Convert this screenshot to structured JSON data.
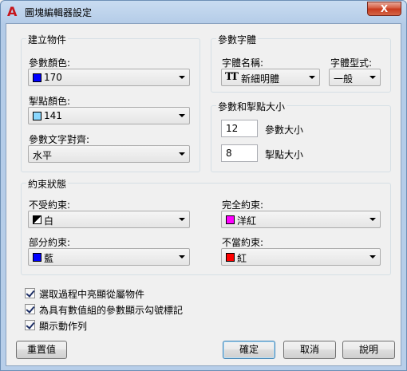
{
  "window": {
    "title": "圖塊編輯器設定",
    "close_label": "X"
  },
  "create_group": {
    "title": "建立物件",
    "param_color_label": "參數顏色:",
    "param_color": {
      "value": "170",
      "swatch": "#0000ff"
    },
    "grip_color_label": "掣點顏色:",
    "grip_color": {
      "value": "141",
      "swatch": "#8ad8ff"
    },
    "text_align_label": "參數文字對齊:",
    "text_align": {
      "value": "水平"
    }
  },
  "font_group": {
    "title": "參數字體",
    "font_name_label": "字體名稱:",
    "font_name": "新細明體",
    "font_style_label": "字體型式:",
    "font_style": "一般"
  },
  "size_group": {
    "title": "參數和掣點大小",
    "param_size": "12",
    "param_size_label": "參數大小",
    "grip_size": "8",
    "grip_size_label": "掣點大小"
  },
  "constraint_group": {
    "title": "約束狀態",
    "unconstrained_label": "不受約束:",
    "unconstrained": {
      "value": "白",
      "swatch_a": "#000000",
      "swatch_b": "#ffffff"
    },
    "fully_label": "完全約束:",
    "fully": {
      "value": "洋紅",
      "swatch": "#ff00ff"
    },
    "partial_label": "部分約束:",
    "partial": {
      "value": "藍",
      "swatch": "#0000ff"
    },
    "improper_label": "不當約束:",
    "improper": {
      "value": "紅",
      "swatch": "#ff0000"
    }
  },
  "options": [
    {
      "label": "選取過程中亮顯從屬物件",
      "checked": true
    },
    {
      "label": "為具有數值組的參數顯示勾號標記",
      "checked": true
    },
    {
      "label": "顯示動作列",
      "checked": true
    }
  ],
  "buttons": {
    "reset": "重置值",
    "ok": "確定",
    "cancel": "取消",
    "help": "說明"
  }
}
